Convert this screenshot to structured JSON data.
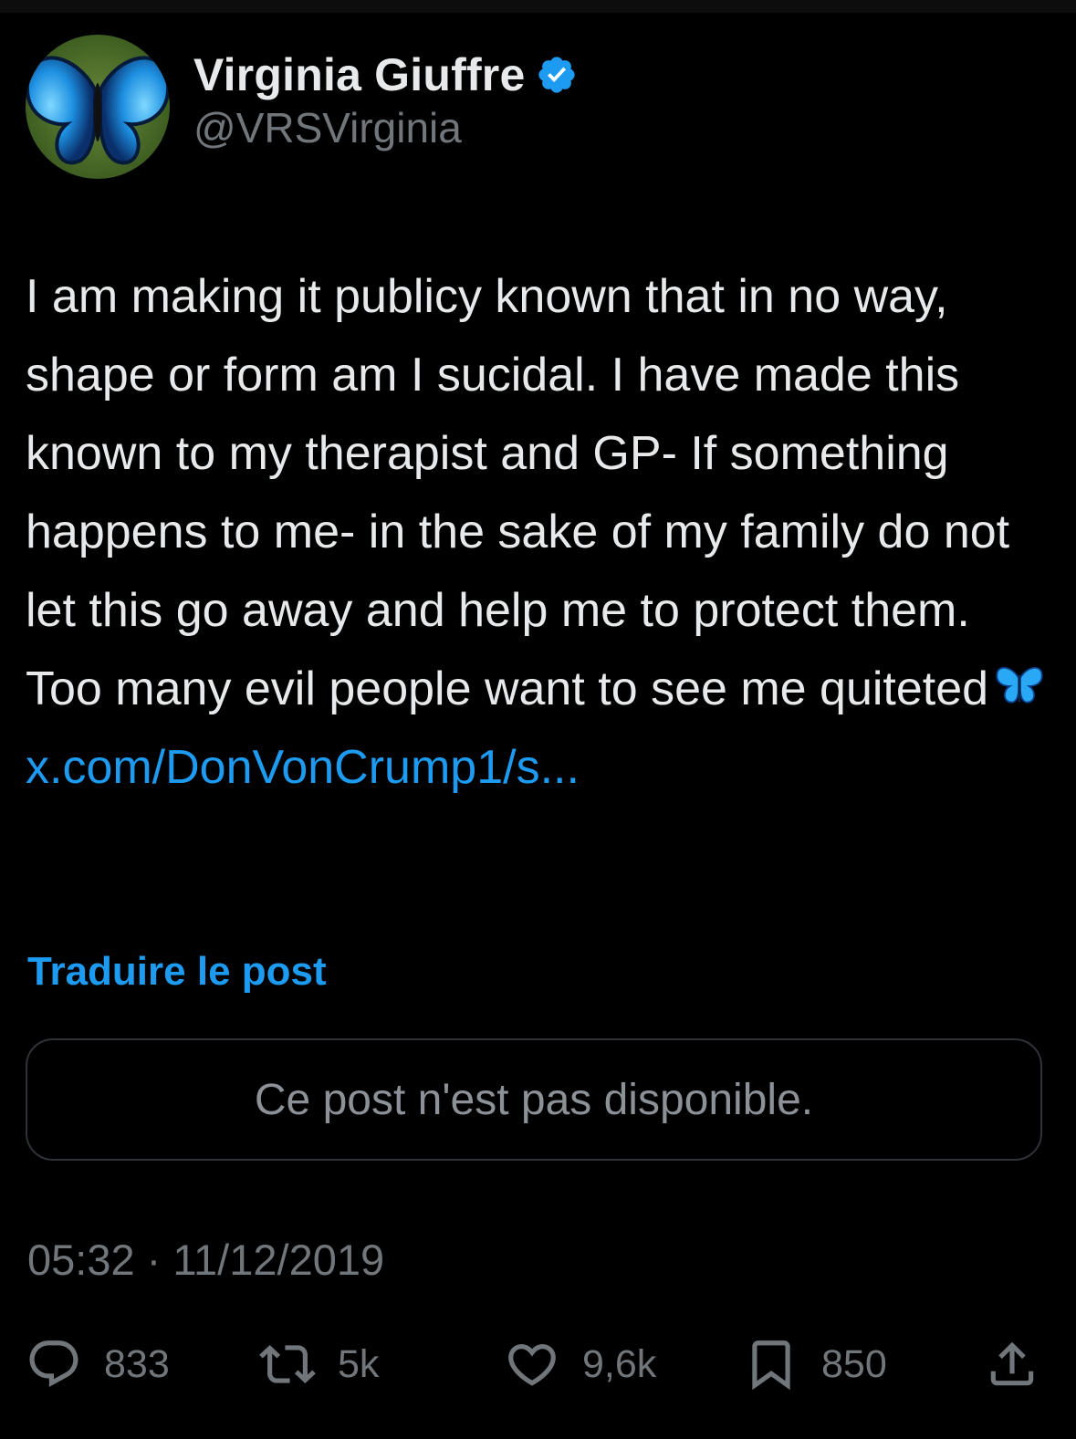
{
  "author": {
    "display_name": "Virginia Giuffre",
    "handle": "@VRSVirginia",
    "verified": true,
    "avatar_icon": "butterfly-avatar"
  },
  "tweet": {
    "text": "I am making it publicy known that in no way, shape or form am I sucidal. I have made this known to my therapist and GP- If something happens to me- in the sake of my family do not let this go away and help me to protect them. Too many evil people want to see me quiteted",
    "emoji": "butterfly-emoji",
    "link": "x.com/DonVonCrump1/s..."
  },
  "translate_label": "Traduire le post",
  "quoted_post": {
    "unavailable_message": "Ce post n'est pas disponible."
  },
  "timestamp": "05:32 · 11/12/2019",
  "actions": {
    "replies": "833",
    "reposts": "5k",
    "likes": "9,6k",
    "bookmarks": "850"
  },
  "colors": {
    "background": "#000000",
    "text": "#e7e9ea",
    "secondary": "#71767b",
    "accent": "#1d9bf0",
    "border": "#2f3336"
  }
}
